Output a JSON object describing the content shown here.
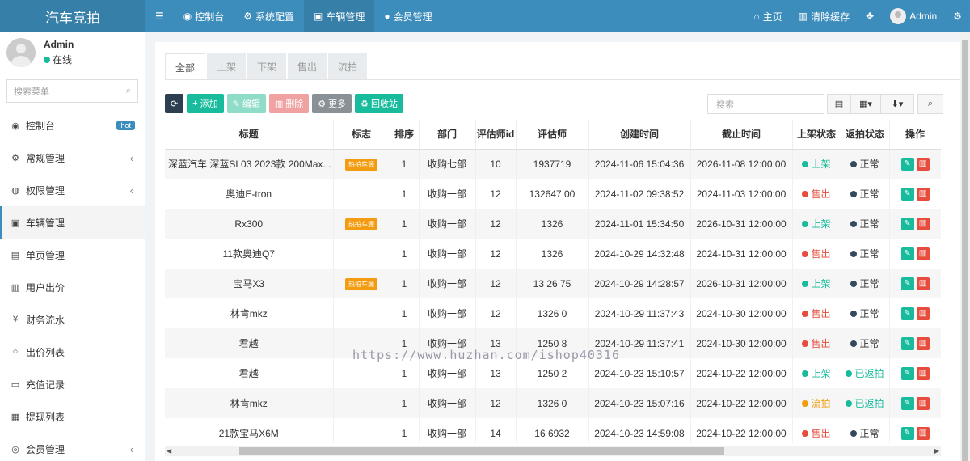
{
  "app": {
    "title": "汽车竞拍"
  },
  "topnav": [
    {
      "icon": "menu-icon",
      "label": ""
    },
    {
      "icon": "dashboard-icon",
      "label": "控制台"
    },
    {
      "icon": "gear-icon",
      "label": "系统配置"
    },
    {
      "icon": "car-icon",
      "label": "车辆管理"
    },
    {
      "icon": "user-icon",
      "label": "会员管理"
    }
  ],
  "topright": {
    "home": "主页",
    "clear_cache": "清除缓存",
    "user": "Admin"
  },
  "sidebar": {
    "user_name": "Admin",
    "user_status": "在线",
    "search_placeholder": "搜索菜单",
    "items": [
      {
        "icon": "dashboard-icon",
        "label": "控制台",
        "badge": "hot"
      },
      {
        "icon": "gears-icon",
        "label": "常规管理",
        "arrow": "‹"
      },
      {
        "icon": "users-icon",
        "label": "权限管理",
        "arrow": "‹"
      },
      {
        "icon": "car-icon",
        "label": "车辆管理"
      },
      {
        "icon": "file-icon",
        "label": "单页管理"
      },
      {
        "icon": "bank-icon",
        "label": "用户出价"
      },
      {
        "icon": "yen-icon",
        "label": "财务流水"
      },
      {
        "icon": "circle-icon",
        "label": "出价列表"
      },
      {
        "icon": "visa-icon",
        "label": "充值记录"
      },
      {
        "icon": "card-icon",
        "label": "提现列表"
      },
      {
        "icon": "user-circle-icon",
        "label": "会员管理",
        "arrow": "‹"
      }
    ]
  },
  "tabs": [
    "全部",
    "上架",
    "下架",
    "售出",
    "流拍"
  ],
  "toolbar": {
    "refresh": "",
    "add": "添加",
    "edit": "编辑",
    "delete": "删除",
    "more": "更多",
    "recycle": "回收站"
  },
  "search_placeholder": "搜索",
  "table": {
    "headers": [
      "标题",
      "标志",
      "排序",
      "部门",
      "评估师id",
      "评估师",
      "创建时间",
      "截止时间",
      "上架状态",
      "返拍状态",
      "操作"
    ],
    "rows": [
      {
        "title": "深蓝汽车 深蓝SL03 2023款 200Max...",
        "flag": "热拍车源",
        "sort": "1",
        "dept": "收购七部",
        "aid": "10",
        "assessor": "1937719",
        "created": "2024-11-06 15:04:36",
        "deadline": "2026-11-08 12:00:00",
        "shelf": "上架",
        "shelf_c": "g",
        "ret": "正常",
        "ret_c": "n"
      },
      {
        "title": "奥迪E-tron",
        "flag": "",
        "sort": "1",
        "dept": "收购一部",
        "aid": "12",
        "assessor": "132647 00",
        "created": "2024-11-02 09:38:52",
        "deadline": "2024-11-03 12:00:00",
        "shelf": "售出",
        "shelf_c": "r",
        "ret": "正常",
        "ret_c": "n"
      },
      {
        "title": "Rx300",
        "flag": "热拍车源",
        "sort": "1",
        "dept": "收购一部",
        "aid": "12",
        "assessor": "1326",
        "created": "2024-11-01 15:34:50",
        "deadline": "2026-10-31 12:00:00",
        "shelf": "上架",
        "shelf_c": "g",
        "ret": "正常",
        "ret_c": "n"
      },
      {
        "title": "11款奥迪Q7",
        "flag": "",
        "sort": "1",
        "dept": "收购一部",
        "aid": "12",
        "assessor": "1326",
        "created": "2024-10-29 14:32:48",
        "deadline": "2024-10-31 12:00:00",
        "shelf": "售出",
        "shelf_c": "r",
        "ret": "正常",
        "ret_c": "n"
      },
      {
        "title": "宝马X3",
        "flag": "热拍车源",
        "sort": "1",
        "dept": "收购一部",
        "aid": "12",
        "assessor": "13 26 75",
        "created": "2024-10-29 14:28:57",
        "deadline": "2026-10-31 12:00:00",
        "shelf": "上架",
        "shelf_c": "g",
        "ret": "正常",
        "ret_c": "n"
      },
      {
        "title": "林肯mkz",
        "flag": "",
        "sort": "1",
        "dept": "收购一部",
        "aid": "12",
        "assessor": "1326 0",
        "created": "2024-10-29 11:37:43",
        "deadline": "2024-10-30 12:00:00",
        "shelf": "售出",
        "shelf_c": "r",
        "ret": "正常",
        "ret_c": "n"
      },
      {
        "title": "君越",
        "flag": "",
        "sort": "1",
        "dept": "收购一部",
        "aid": "13",
        "assessor": "1250 8",
        "created": "2024-10-29 11:37:41",
        "deadline": "2024-10-30 12:00:00",
        "shelf": "售出",
        "shelf_c": "r",
        "ret": "正常",
        "ret_c": "n"
      },
      {
        "title": "君越",
        "flag": "",
        "sort": "1",
        "dept": "收购一部",
        "aid": "13",
        "assessor": "1250 2",
        "created": "2024-10-23 15:10:57",
        "deadline": "2024-10-22 12:00:00",
        "shelf": "上架",
        "shelf_c": "g",
        "ret": "已返拍",
        "ret_c": "g"
      },
      {
        "title": "林肯mkz",
        "flag": "",
        "sort": "1",
        "dept": "收购一部",
        "aid": "12",
        "assessor": "1326 0",
        "created": "2024-10-23 15:07:16",
        "deadline": "2024-10-22 12:00:00",
        "shelf": "流拍",
        "shelf_c": "o",
        "ret": "已返拍",
        "ret_c": "g"
      },
      {
        "title": "21款宝马X6M",
        "flag": "",
        "sort": "1",
        "dept": "收购一部",
        "aid": "14",
        "assessor": "16 6932",
        "created": "2024-10-23 14:59:08",
        "deadline": "2024-10-22 12:00:00",
        "shelf": "售出",
        "shelf_c": "r",
        "ret": "正常",
        "ret_c": "n"
      }
    ]
  },
  "watermark": "https://www.huzhan.com/ishop40316",
  "colors": {
    "primary": "#3c8dbc",
    "success": "#18bc9c",
    "danger": "#e74c3c",
    "warning": "#f39c12",
    "dark": "#2c3e50"
  }
}
